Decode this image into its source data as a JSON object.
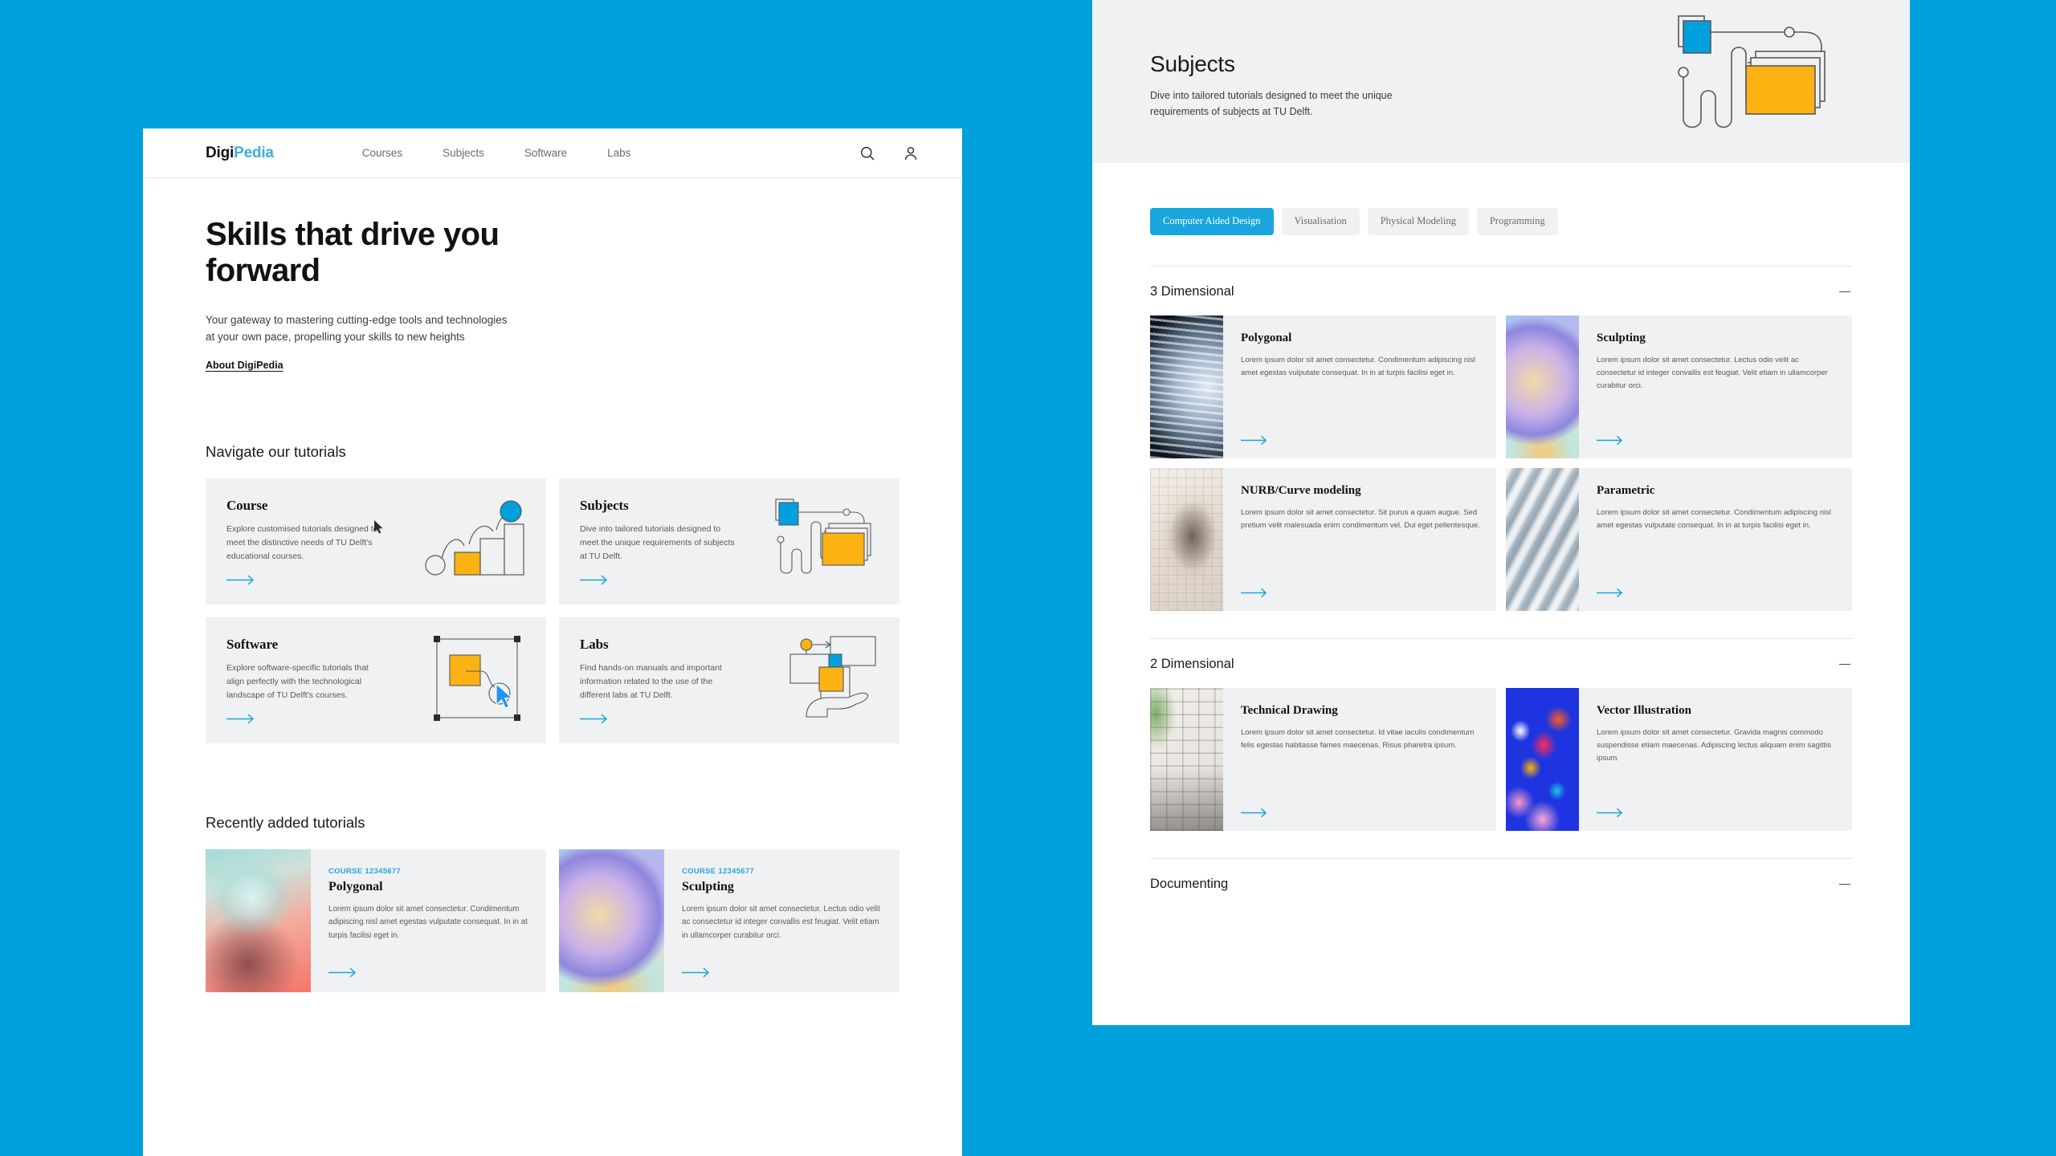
{
  "theme": {
    "page_background": "#00a0dc",
    "accent_blue": "#00a0dc",
    "accent_yellow": "#fbb212",
    "card_background": "#f0f1f2",
    "link_blue": "#29a3e0"
  },
  "left_window": {
    "nav": {
      "logo_first": "Digi",
      "logo_second": "Pedia",
      "links": [
        {
          "label": "Courses"
        },
        {
          "label": "Subjects"
        },
        {
          "label": "Software"
        },
        {
          "label": "Labs"
        }
      ],
      "icons": [
        {
          "name": "search-icon"
        },
        {
          "name": "user-account-icon"
        }
      ]
    },
    "hero": {
      "title": "Skills that drive you forward",
      "subtitle": "Your gateway to mastering cutting-edge tools and technologies at your own pace, propelling your skills to new heights",
      "link_label": "About DigiPedia"
    },
    "navigate_section": {
      "title": "Navigate our tutorials",
      "cards": [
        {
          "title": "Course",
          "description": "Explore customised tutorials designed to meet the distinctive needs of TU Delft's educational courses.",
          "active": true,
          "art": "bar-chart-art"
        },
        {
          "title": "Subjects",
          "description": "Dive into tailored tutorials designed to meet the unique requirements of subjects at TU Delft.",
          "active": false,
          "art": "stacked-cards-art"
        },
        {
          "title": "Software",
          "description": "Explore software-specific tutorials that align perfectly with the technological landscape of TU Delft's courses.",
          "active": false,
          "art": "selection-box-art"
        },
        {
          "title": "Labs",
          "description": "Find hands-on manuals and important information related to the use of the different labs at TU Delft.",
          "active": false,
          "art": "hand-panels-art"
        }
      ]
    },
    "recent_section": {
      "title": "Recently added tutorials",
      "cards": [
        {
          "eyebrow": "COURSE 12345677",
          "title": "Polygonal",
          "description": "Lorem ipsum dolor sit amet consectetur. Condimentum adipiscing nisl amet egestas vulputate consequat. In in at turpis facilisi eget in.",
          "thumb": "lightbulb-photo"
        },
        {
          "eyebrow": "COURSE 12345677",
          "title": "Sculpting",
          "description": "Lorem ipsum dolor sit amet consectetur. Lectus odio velit ac consectetur id integer convallis est feugiat. Velit etiam in ullamcorper curabitur orci.",
          "thumb": "gradient-sphere-render"
        }
      ]
    }
  },
  "right_window": {
    "header": {
      "title": "Subjects",
      "subtitle": "Dive into tailored tutorials designed to meet the unique requirements of subjects at TU Delft.",
      "art": "stacked-cards-art"
    },
    "chips": [
      {
        "label": "Computer Aided Design",
        "active": true
      },
      {
        "label": "Visualisation",
        "active": false
      },
      {
        "label": "Physical Modeling",
        "active": false
      },
      {
        "label": "Programming",
        "active": false
      }
    ],
    "sections": [
      {
        "title": "3 Dimensional",
        "expanded": true,
        "toggle_glyph": "minus-icon",
        "cards": [
          {
            "title": "Polygonal",
            "description": "Lorem ipsum dolor sit amet consectetur. Condimentum adipiscing nisl amet egestas vulputate consequat. In in at turpis facilisi eget in.",
            "thumb": "dark-striped-sphere-photo"
          },
          {
            "title": "Sculpting",
            "description": "Lorem ipsum dolor sit amet consectetur. Lectus odio velit ac consectetur id integer convallis est feugiat. Velit etiam in ullamcorper curabitur orci.",
            "thumb": "gradient-sphere-render"
          },
          {
            "title": "NURB/Curve modeling",
            "description": "Lorem ipsum dolor sit amet consectetur. Sit purus a quam augue. Sed pretium velit malesuada enim condimentum vel. Dui eget pellentesque.",
            "thumb": "nurb-mesh-render"
          },
          {
            "title": "Parametric",
            "description": "Lorem ipsum dolor sit amet consectetur. Condimentum adipiscing nisl amet egestas vulputate consequat. In in at turpis facilisi eget in.",
            "thumb": "parametric-wave-wall-photo"
          }
        ]
      },
      {
        "title": "2 Dimensional",
        "expanded": true,
        "toggle_glyph": "minus-icon",
        "cards": [
          {
            "title": "Technical Drawing",
            "description": "Lorem ipsum dolor sit amet consectetur. Id vitae iaculis condimentum felis egestas habitasse fames maecenas. Risus pharetra ipsum.",
            "thumb": "laptop-floorplan-photo"
          },
          {
            "title": "Vector Illustration",
            "description": "Lorem ipsum dolor sit amet consectetur. Gravida magnis commodo suspendisse etiam maecenas. Adipiscing lectus aliquam enim sagittis ipsum.",
            "thumb": "colorful-sneaker-illustration"
          }
        ]
      },
      {
        "title": "Documenting",
        "expanded": true,
        "toggle_glyph": "minus-icon",
        "cards": []
      }
    ]
  }
}
